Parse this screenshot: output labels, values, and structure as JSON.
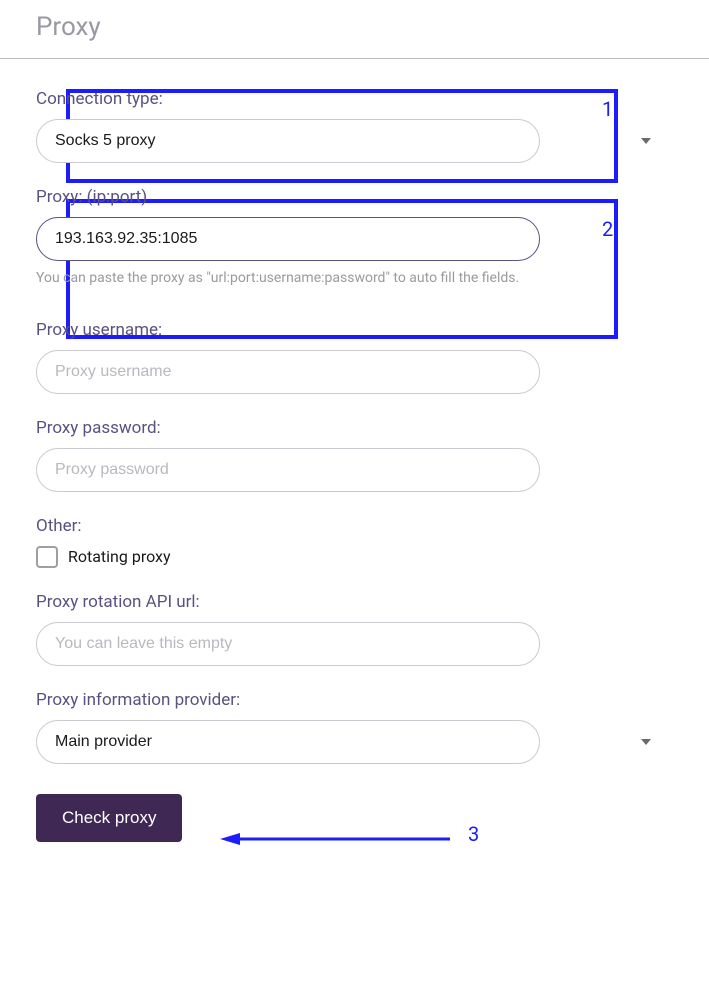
{
  "header": {
    "title": "Proxy"
  },
  "connection": {
    "label": "Connection type:",
    "value": "Socks 5 proxy"
  },
  "proxy": {
    "label": "Proxy: (ip:port)",
    "value": "193.163.92.35:1085",
    "hint": "You can paste the proxy as \"url:port:username:password\" to auto fill the fields."
  },
  "username": {
    "label": "Proxy username:",
    "placeholder": "Proxy username"
  },
  "password": {
    "label": "Proxy password:",
    "placeholder": "Proxy password"
  },
  "other": {
    "label": "Other:",
    "checkbox_label": "Rotating proxy"
  },
  "rotation": {
    "label": "Proxy rotation API url:",
    "placeholder": "You can leave this empty"
  },
  "provider": {
    "label": "Proxy information provider:",
    "value": "Main provider"
  },
  "button": {
    "check_proxy": "Check proxy"
  },
  "annotations": {
    "a1": "1",
    "a2": "2",
    "a3": "3"
  }
}
